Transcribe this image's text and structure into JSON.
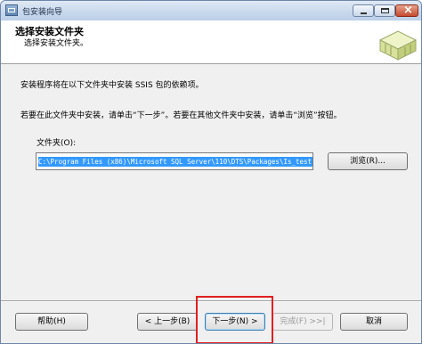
{
  "window": {
    "title": "包安装向导"
  },
  "header": {
    "title": "选择安装文件夹",
    "subtitle": "选择安装文件夹。"
  },
  "body": {
    "line1": "安装程序将在以下文件夹中安装 SSIS 包的依赖项。",
    "line2": "若要在此文件夹中安装，请单击“下一步”。若要在其他文件夹中安装，请单击“浏览”按钮。",
    "folder_label": "文件夹(O):",
    "folder_value": "C:\\Program Files (x86)\\Microsoft SQL Server\\110\\DTS\\Packages\\Is_test",
    "browse_label": "浏览(R)..."
  },
  "footer": {
    "help_label": "帮助(H)",
    "back_label": "< 上一步(B)",
    "next_label": "下一步(N) >",
    "finish_label": "完成(F) >>|",
    "cancel_label": "取消"
  },
  "colors": {
    "selection": "#3399ff",
    "highlight_box": "#e02020",
    "title_bar": "#c7d8ec"
  },
  "icons": [
    "package-icon",
    "minimize-icon",
    "maximize-icon",
    "close-icon",
    "package-wizard-graphic"
  ]
}
